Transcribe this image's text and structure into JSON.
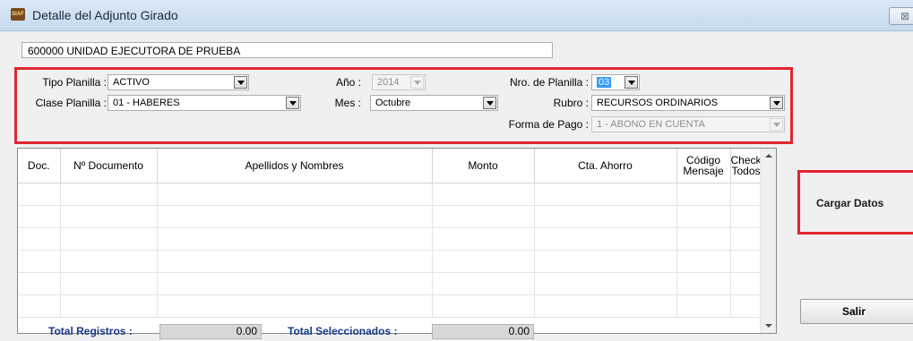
{
  "window": {
    "title": "Detalle del Adjunto Girado",
    "app_icon_text": "SIAF",
    "close_glyph": "⊠"
  },
  "unidad": "600000 UNIDAD EJECUTORA DE PRUEBA",
  "filters": {
    "tipo_planilla": {
      "label": "Tipo Planilla :",
      "value": "ACTIVO"
    },
    "clase_planilla": {
      "label": "Clase Planilla :",
      "value": "01 - HABERES"
    },
    "anio": {
      "label": "Año :",
      "value": "2014"
    },
    "mes": {
      "label": "Mes :",
      "value": "Octubre"
    },
    "nro_planilla": {
      "label": "Nro. de Planilla :",
      "value": "03"
    },
    "rubro": {
      "label": "Rubro :",
      "value": "RECURSOS ORDINARIOS"
    },
    "forma_pago": {
      "label": "Forma de Pago :",
      "value": "1 - ABONO EN CUENTA"
    }
  },
  "grid": {
    "columns": [
      "Doc.",
      "Nº Documento",
      "Apellidos y Nombres",
      "Monto",
      "Cta. Ahorro"
    ],
    "col_codigo": [
      "Código",
      "Mensaje"
    ],
    "col_check": [
      "Check",
      "Todos"
    ],
    "empty_rows": 6
  },
  "footer": {
    "total_registros_label": "Total Registros :",
    "total_registros_value": "0.00",
    "total_seleccionados_label": "Total Seleccionados :",
    "total_seleccionados_value": "0.00"
  },
  "buttons": {
    "cargar_datos": "Cargar Datos",
    "salir": "Salir"
  },
  "colors": {
    "highlight_border": "#e0262e",
    "footer_label": "#1a3a8a",
    "selection": "#3399ff"
  }
}
